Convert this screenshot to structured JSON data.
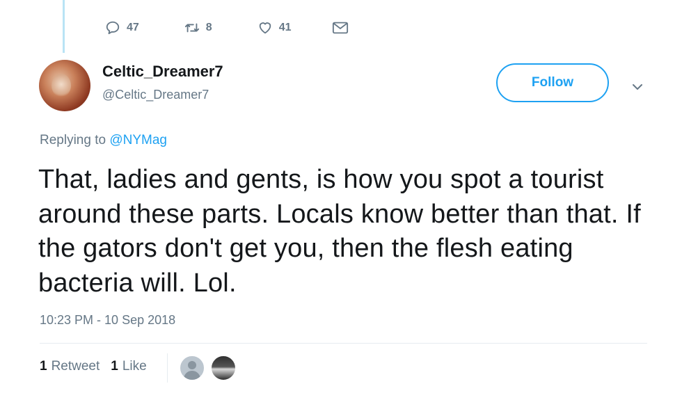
{
  "previous_tweet": {
    "reply_count": "47",
    "retweet_count": "8",
    "like_count": "41"
  },
  "user": {
    "display_name": "Celtic_Dreamer7",
    "handle": "@Celtic_Dreamer7"
  },
  "follow_label": "Follow",
  "replying": {
    "prefix": "Replying to",
    "mention": "@NYMag"
  },
  "tweet": {
    "text": "That, ladies and gents, is how you spot a tourist around these parts. Locals know better than that. If the gators don't get you, then the flesh eating bacteria will. Lol.",
    "timestamp": "10:23 PM - 10 Sep 2018"
  },
  "stats": {
    "retweets_count": "1",
    "retweets_label": "Retweet",
    "likes_count": "1",
    "likes_label": "Like"
  },
  "icons": {
    "reply": "reply-icon",
    "retweet": "retweet-icon",
    "like": "heart-icon",
    "dm": "envelope-icon",
    "caret": "chevron-down-icon"
  },
  "colors": {
    "accent": "#1da1f2",
    "muted": "#657786",
    "text": "#14171a",
    "thread_line": "#b9e3f5"
  }
}
